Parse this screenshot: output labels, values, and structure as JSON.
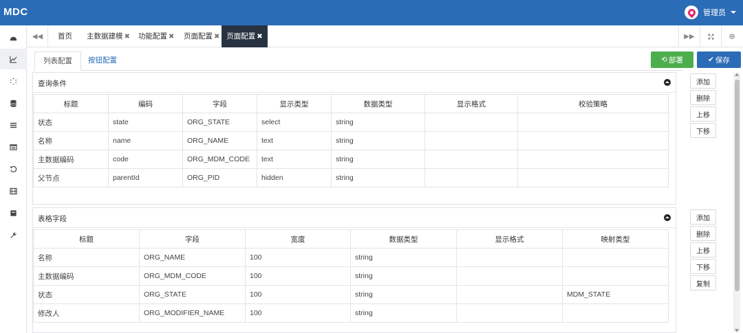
{
  "app": {
    "logo": "MDC",
    "user_name": "管理员"
  },
  "sidebar_icons": [
    "dashboard-icon",
    "chart-icon",
    "spinner-icon",
    "database-icon",
    "list-icon",
    "table-icon",
    "history-icon",
    "film-icon",
    "archive-icon",
    "wrench-icon"
  ],
  "tabs": {
    "items": [
      {
        "label": "首页",
        "closable": false
      },
      {
        "label": "主数据建模",
        "closable": true
      },
      {
        "label": "功能配置",
        "closable": true
      },
      {
        "label": "页面配置",
        "closable": true
      },
      {
        "label": "页面配置",
        "closable": true,
        "active": true
      }
    ],
    "close_glyph": "✖"
  },
  "subtabs": [
    "列表配置",
    "按钮配置"
  ],
  "actions": {
    "deploy": "部署",
    "save": "保存"
  },
  "query_panel": {
    "title": "查询条件",
    "columns": [
      "标题",
      "编码",
      "字段",
      "显示类型",
      "数据类型",
      "显示格式",
      "校验策略"
    ],
    "rows": [
      [
        "状态",
        "state",
        "ORG_STATE",
        "select",
        "string",
        "",
        ""
      ],
      [
        "名称",
        "name",
        "ORG_NAME",
        "text",
        "string",
        "",
        ""
      ],
      [
        "主数据编码",
        "code",
        "ORG_MDM_CODE",
        "text",
        "string",
        "",
        ""
      ],
      [
        "父节点",
        "parentId",
        "ORG_PID",
        "hidden",
        "string",
        "",
        ""
      ]
    ],
    "buttons": [
      "添加",
      "删除",
      "上移",
      "下移"
    ]
  },
  "grid_panel": {
    "title": "表格字段",
    "columns": [
      "标题",
      "字段",
      "宽度",
      "数据类型",
      "显示格式",
      "映射类型"
    ],
    "rows": [
      [
        "名称",
        "ORG_NAME",
        "100",
        "string",
        "",
        ""
      ],
      [
        "主数据编码",
        "ORG_MDM_CODE",
        "100",
        "string",
        "",
        ""
      ],
      [
        "状态",
        "ORG_STATE",
        "100",
        "string",
        "",
        "MDM_STATE"
      ],
      [
        "修改人",
        "ORG_MODIFIER_NAME",
        "100",
        "string",
        "",
        ""
      ]
    ],
    "buttons": [
      "添加",
      "删除",
      "上移",
      "下移",
      "复制"
    ]
  }
}
